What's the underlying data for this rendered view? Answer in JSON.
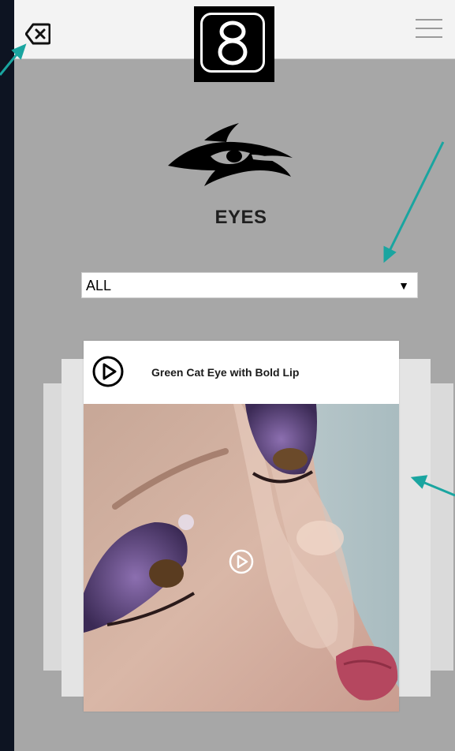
{
  "header": {
    "back_icon": "backspace-icon",
    "logo_icon": "brand-8-icon",
    "menu_icon": "hamburger-menu-icon"
  },
  "section": {
    "title": "EYES",
    "brand_icon": "eye-brand-logo-icon"
  },
  "filter": {
    "selected": "ALL",
    "arrow": "▼"
  },
  "card": {
    "title": "Green Cat Eye with Bold Lip",
    "play_icon": "play-circle-icon",
    "image_icon": "video-thumbnail-image"
  },
  "colors": {
    "page_bg": "#a7a7a7",
    "frame_bg": "#0d1422",
    "annotation_arrow": "#1aa5a0"
  }
}
